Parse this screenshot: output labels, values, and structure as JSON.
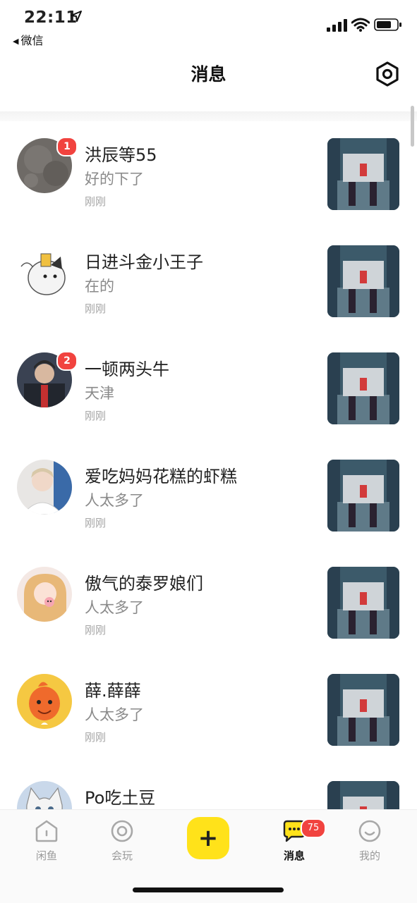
{
  "status_bar": {
    "time": "22:11",
    "back_app": "微信"
  },
  "header": {
    "title": "消息"
  },
  "conversations": [
    {
      "name": "洪辰等55",
      "message": "好的下了",
      "time": "刚刚",
      "badge": "1"
    },
    {
      "name": "日进斗金小王子",
      "message": "在的",
      "time": "刚刚",
      "badge": ""
    },
    {
      "name": "一顿两头牛",
      "message": "天津",
      "time": "刚刚",
      "badge": "2"
    },
    {
      "name": "爱吃妈妈花糕的虾糕",
      "message": "人太多了",
      "time": "刚刚",
      "badge": ""
    },
    {
      "name": "傲气的泰罗娘们",
      "message": "人太多了",
      "time": "刚刚",
      "badge": ""
    },
    {
      "name": "薛.薛薛",
      "message": "人太多了",
      "time": "刚刚",
      "badge": ""
    },
    {
      "name": "Po吃土豆",
      "message": "",
      "time": "",
      "badge": ""
    }
  ],
  "tabbar": {
    "tabs": [
      {
        "label": "闲鱼"
      },
      {
        "label": "会玩"
      },
      {
        "label": "+"
      },
      {
        "label": "消息",
        "badge": "75"
      },
      {
        "label": "我的"
      }
    ]
  },
  "colors": {
    "accent": "#ffe21a",
    "badge": "#f1433f"
  }
}
